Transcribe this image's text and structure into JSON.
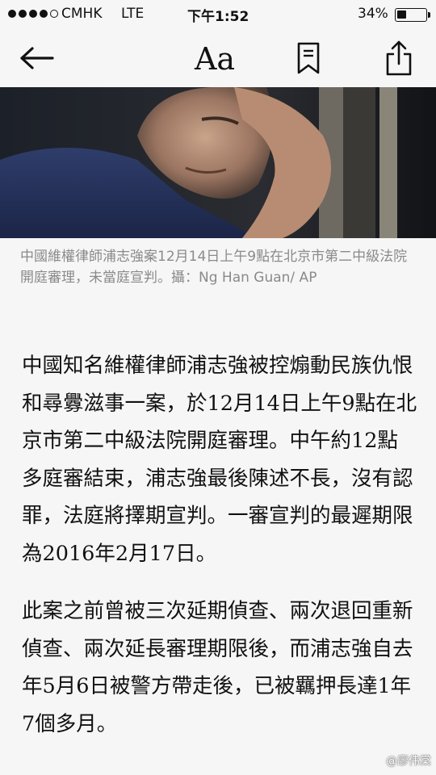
{
  "status_bar": {
    "carrier": "CMHK",
    "network": "LTE",
    "time": "下午1:52",
    "battery_percent": "34%",
    "battery_level": 0.34
  },
  "toolbar": {
    "back_icon": "left-arrow-icon",
    "font_label": "Aa",
    "bookmark_icon": "bookmark-icon",
    "share_icon": "share-icon"
  },
  "photo": {
    "caption": "中國維權律師浦志強案12月14日上午9點在北京市第二中級法院開庭審理，未當庭宣判。攝：Ng Han Guan/ AP"
  },
  "article": {
    "paragraphs": [
      "中國知名維權律師浦志強被控煽動民族仇恨和尋釁滋事一案，於12月14日上午9點在北京市第二中級法院開庭審理。中午約12點多庭審結束，浦志強最後陳述不長，沒有認罪，法庭將擇期宣判。一審宣判的最遲期限為2016年2月17日。",
      "此案之前曾被三次延期偵查、兩次退回重新偵查、兩次延長審理期限後，而浦志強自去年5月6日被警方帶走後，已被羈押長達1年7個多月。"
    ]
  },
  "watermark": "@廖伟棠",
  "colors": {
    "background": "#f6f6f6",
    "caption": "#8a8a8a",
    "text": "#111111"
  }
}
